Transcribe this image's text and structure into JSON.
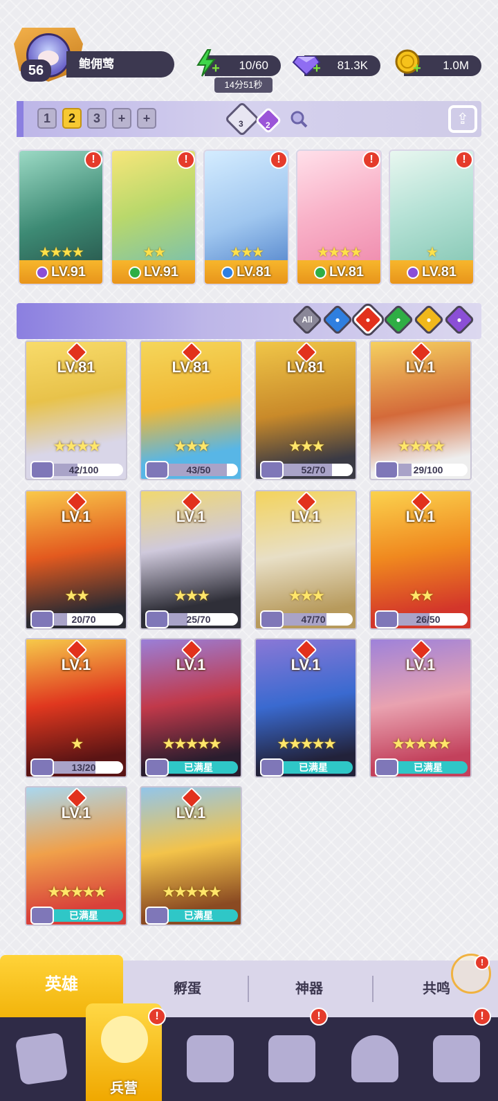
{
  "player": {
    "level": "56",
    "name": "鲍佣莺"
  },
  "resources": {
    "energy": "10/60",
    "energy_timer": "14分51秒",
    "gems": "81.3K",
    "gold": "1.0M"
  },
  "team_tabs": [
    "1",
    "2",
    "3",
    "+",
    "+"
  ],
  "team_active": "2",
  "team_elements": {
    "diamond_count": "3",
    "purple_count": "2"
  },
  "team": [
    {
      "level": "LV.91",
      "stars": "★★★★",
      "element": "dark",
      "alert": "!"
    },
    {
      "level": "LV.91",
      "stars": "★★",
      "element": "nature",
      "alert": "!"
    },
    {
      "level": "LV.81",
      "stars": "★★★",
      "element": "water",
      "alert": "!"
    },
    {
      "level": "LV.81",
      "stars": "★★★★",
      "element": "nature",
      "alert": "!"
    },
    {
      "level": "LV.81",
      "stars": "★",
      "element": "dark",
      "alert": "!"
    }
  ],
  "filters": [
    "All",
    "water",
    "fire",
    "nature",
    "light",
    "dark"
  ],
  "filter_selected": "fire",
  "heroes": [
    {
      "level": "LV.81",
      "stars": "★★★★",
      "progress": "42/100",
      "ratio": 0.42,
      "tier": "gold"
    },
    {
      "level": "LV.81",
      "stars": "★★★",
      "progress": "43/50",
      "ratio": 0.86,
      "tier": "gold"
    },
    {
      "level": "LV.81",
      "stars": "★★★",
      "progress": "52/70",
      "ratio": 0.74,
      "tier": "gold"
    },
    {
      "level": "LV.1",
      "stars": "★★★★",
      "progress": "29/100",
      "ratio": 0.29,
      "tier": "gold"
    },
    {
      "level": "LV.1",
      "stars": "★★",
      "progress": "20/70",
      "ratio": 0.29,
      "tier": "gold"
    },
    {
      "level": "LV.1",
      "stars": "★★★",
      "progress": "25/70",
      "ratio": 0.36,
      "tier": "gold"
    },
    {
      "level": "LV.1",
      "stars": "★★★",
      "progress": "47/70",
      "ratio": 0.67,
      "tier": "gold"
    },
    {
      "level": "LV.1",
      "stars": "★★",
      "progress": "26/50",
      "ratio": 0.52,
      "tier": "gold"
    },
    {
      "level": "LV.1",
      "stars": "★",
      "progress": "13/20",
      "ratio": 0.65,
      "tier": "gold"
    },
    {
      "level": "LV.1",
      "stars": "★★★★★",
      "progress": "已满星",
      "ratio": 1,
      "tier": "purple"
    },
    {
      "level": "LV.1",
      "stars": "★★★★★",
      "progress": "已满星",
      "ratio": 1,
      "tier": "purple"
    },
    {
      "level": "LV.1",
      "stars": "★★★★★",
      "progress": "已满星",
      "ratio": 1,
      "tier": "purple"
    },
    {
      "level": "LV.1",
      "stars": "★★★★★",
      "progress": "已满星",
      "ratio": 1,
      "tier": "blue"
    },
    {
      "level": "LV.1",
      "stars": "★★★★★",
      "progress": "已满星",
      "ratio": 1,
      "tier": "blue"
    }
  ],
  "sub_tabs": [
    "英雄",
    "孵蛋",
    "神器",
    "共鸣"
  ],
  "nav": {
    "active_label": "兵营"
  },
  "colors": {
    "accent": "#f7c932",
    "bg": "#ececf0",
    "nav": "#2f2b47",
    "alert": "#e53b2b"
  }
}
